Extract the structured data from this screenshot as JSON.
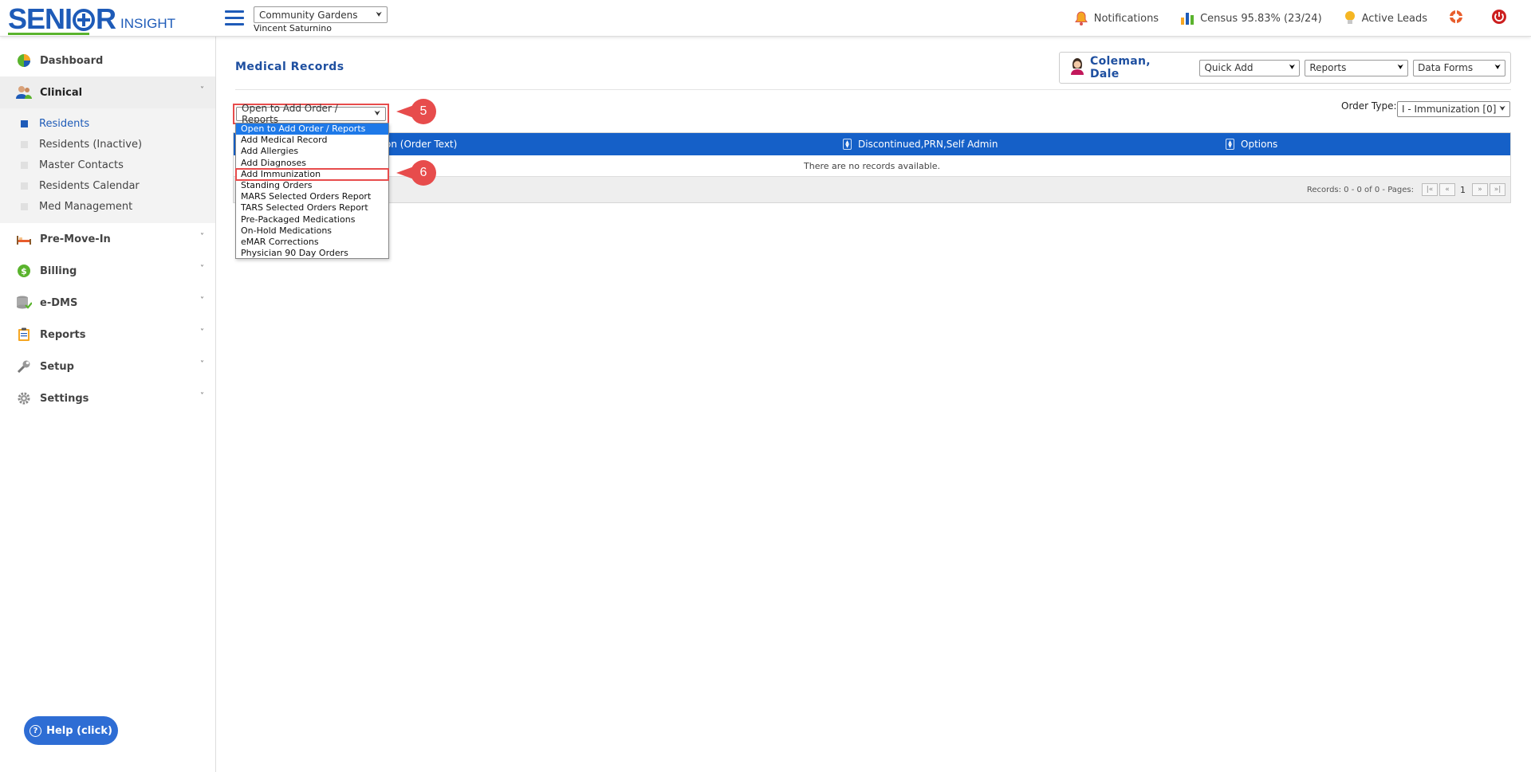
{
  "brand": {
    "name_part1": "SENI",
    "name_part2": "R",
    "name_part3": "INSIGHT"
  },
  "header": {
    "community": "Community Gardens",
    "user": "Vincent Saturnino",
    "notifications": "Notifications",
    "census": "Census 95.83% (23/24)",
    "active_leads": "Active Leads"
  },
  "sidebar": {
    "items": [
      {
        "label": "Dashboard"
      },
      {
        "label": "Clinical"
      },
      {
        "label": "Pre-Move-In"
      },
      {
        "label": "Billing"
      },
      {
        "label": "e-DMS"
      },
      {
        "label": "Reports"
      },
      {
        "label": "Setup"
      },
      {
        "label": "Settings"
      }
    ],
    "clinical_sub": [
      {
        "label": "Residents"
      },
      {
        "label": "Residents (Inactive)"
      },
      {
        "label": "Master Contacts"
      },
      {
        "label": "Residents Calendar"
      },
      {
        "label": "Med Management"
      }
    ],
    "help": "Help (click)"
  },
  "main": {
    "title": "Medical Records",
    "resident": "Coleman, Dale",
    "quick_add": "Quick Add",
    "reports": "Reports",
    "data_forms": "Data Forms",
    "order_select": "Open to Add Order / Reports",
    "order_type_label": "Order Type:",
    "order_type_value": "I - Immunization [0]",
    "columns": [
      "on (Order Text)",
      "Discontinued,PRN,Self Admin",
      "Options"
    ],
    "empty_text": "There are no records available.",
    "records_text": "Records: 0 - 0 of 0 - Pages:",
    "page_number": "1"
  },
  "dropdown": {
    "options": [
      "Open to Add Order / Reports",
      "Add Medical Record",
      "Add Allergies",
      "Add Diagnoses",
      "Add Immunization",
      "Standing Orders",
      "MARS Selected Orders Report",
      "TARS Selected Orders Report",
      "Pre-Packaged Medications",
      "On-Hold Medications",
      "eMAR Corrections",
      "Physician 90 Day Orders"
    ]
  },
  "callouts": {
    "step5": "5",
    "step6": "6"
  },
  "colors": {
    "brand_blue": "#1e5bb8",
    "header_blue": "#1560c8",
    "accent_red": "#e74c4c",
    "green": "#5ab32d"
  }
}
